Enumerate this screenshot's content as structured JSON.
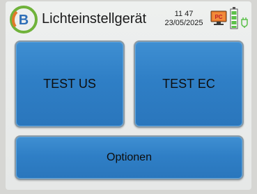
{
  "header": {
    "title": "Lichteinstellgerät",
    "time": "11 47",
    "date": "23/05/2025",
    "monitor_badge": "PC"
  },
  "buttons": {
    "test_us": "TEST US",
    "test_ec": "TEST EC",
    "options": "Optionen"
  },
  "icons": {
    "logo": "cb-logo",
    "monitor": "monitor-icon",
    "battery": "battery-icon",
    "plug": "plug-icon"
  },
  "colors": {
    "button_blue": "#2f7fc6",
    "logo_green": "#6fb23a",
    "logo_blue": "#2f6fb8",
    "logo_orange": "#e0792a",
    "battery_green": "#5cc04a",
    "monitor_orange": "#e7772b"
  }
}
